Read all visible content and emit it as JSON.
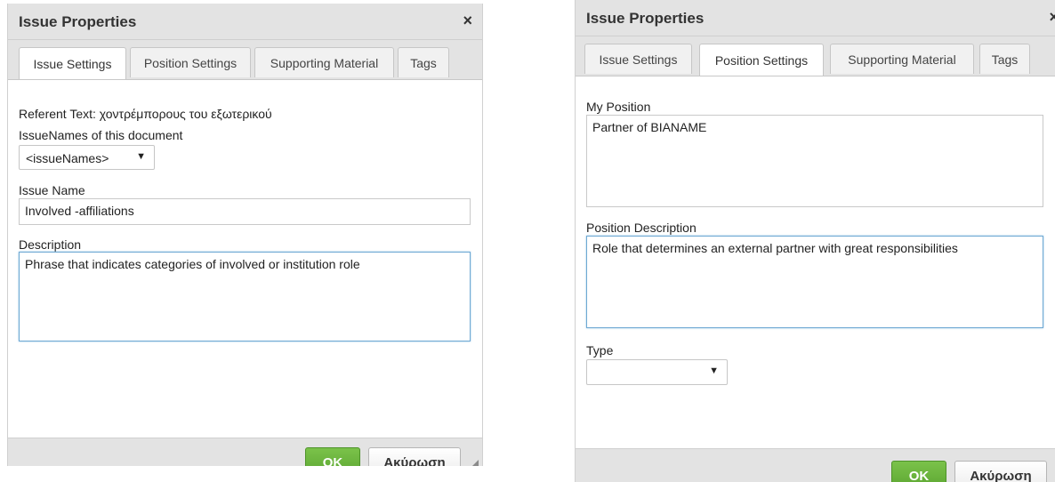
{
  "left_dialog": {
    "title": "Issue Properties",
    "close_glyph": "×",
    "tabs": [
      {
        "label": "Issue Settings",
        "active": true
      },
      {
        "label": "Position Settings",
        "active": false
      },
      {
        "label": "Supporting Material",
        "active": false
      },
      {
        "label": "Tags",
        "active": false
      }
    ],
    "referent_text": "Referent Text: χοντρέμπορους του εξωτερικού",
    "issue_names_label": "IssueNames of this document",
    "issue_names_select": "<issueNames>",
    "issue_name_label": "Issue Name",
    "issue_name_value": "Involved -affiliations",
    "description_label": "Description",
    "description_value": "Phrase that indicates categories of involved or institution role",
    "ok_label": "OK",
    "cancel_label": "Ακύρωση"
  },
  "right_dialog": {
    "title": "Issue Properties",
    "close_glyph": "×",
    "tabs": [
      {
        "label": "Issue Settings",
        "active": false
      },
      {
        "label": "Position Settings",
        "active": true
      },
      {
        "label": "Supporting Material",
        "active": false
      },
      {
        "label": "Tags",
        "active": false
      }
    ],
    "my_position_label": "My Position",
    "my_position_value": "Partner of BIANAME",
    "position_description_label": "Position Description",
    "position_description_value": "Role that determines an external partner with great responsibilities",
    "type_label": "Type",
    "type_select": "",
    "ok_label": "OK",
    "cancel_label": "Ακύρωση"
  },
  "icons": {
    "dropdown_arrow": "▼",
    "close": "close-icon",
    "resize": "resize-grip-icon"
  },
  "colors": {
    "ok_button": "#5aa531",
    "focus_border": "#6ea9d3",
    "titlebar": "#e3e3e3"
  }
}
